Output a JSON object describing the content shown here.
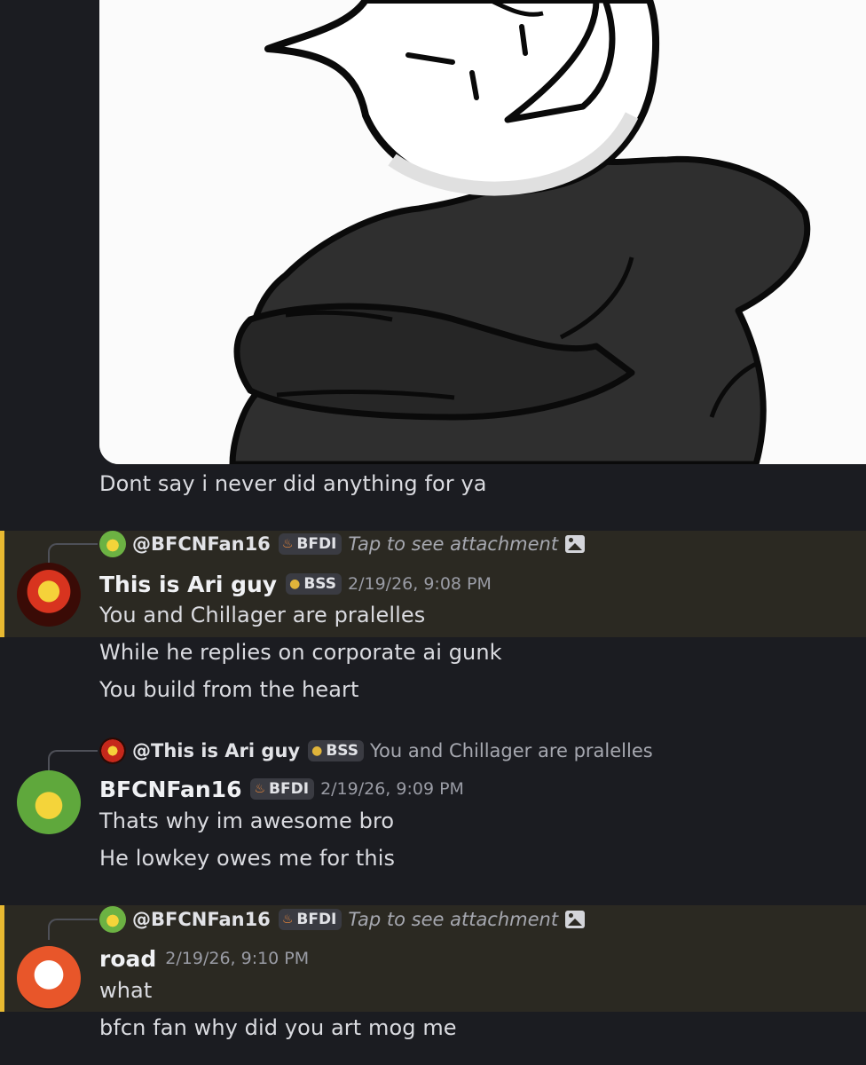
{
  "messages": {
    "first_tail": {
      "line": "Dont say i never did anything for ya"
    },
    "ari": {
      "reply": {
        "name": "@BFCNFan16",
        "tag": "BFDI",
        "preview": "Tap to see attachment"
      },
      "author": "This is Ari guy",
      "tag": "BSS",
      "time": "2/19/26, 9:08 PM",
      "lines": [
        "You and Chillager are pralelles",
        "While he replies on corporate ai gunk",
        "You build from the heart"
      ]
    },
    "bfcn": {
      "reply": {
        "name": "@This is Ari guy",
        "tag": "BSS",
        "preview": "You and Chillager are pralelles"
      },
      "author": "BFCNFan16",
      "tag": "BFDI",
      "time": "2/19/26, 9:09 PM",
      "lines": [
        "Thats why im awesome bro",
        "He lowkey owes me for this"
      ]
    },
    "road": {
      "reply": {
        "name": "@BFCNFan16",
        "tag": "BFDI",
        "preview": "Tap to see attachment"
      },
      "author": "road",
      "time": "2/19/26, 9:10 PM",
      "lines": [
        "what",
        "bfcn fan why did you art mog me"
      ]
    }
  },
  "icons": {
    "bfdi_tag": "flame-icon",
    "bss_tag": "gold-drop-icon",
    "attachment": "image-icon"
  },
  "colors": {
    "background": "#1b1c21",
    "highlight": "#2b2922",
    "highlight_bar": "#e8b931",
    "tag_bg": "#3a3b42"
  }
}
